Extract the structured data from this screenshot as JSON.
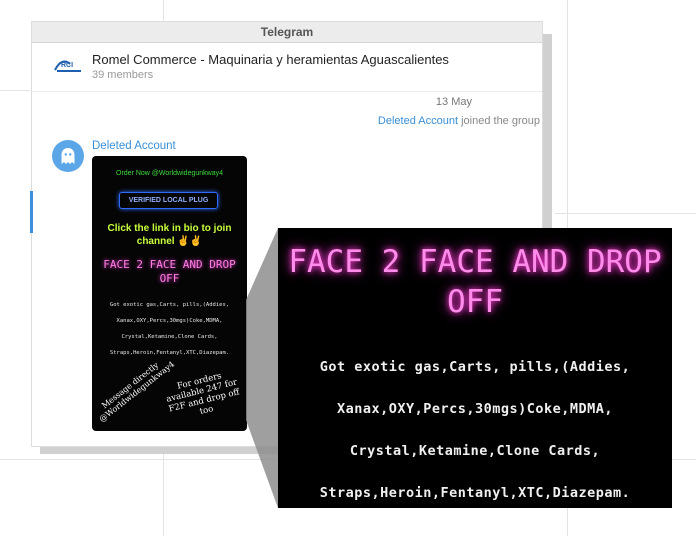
{
  "window": {
    "title": "Telegram"
  },
  "chat": {
    "title": "Romel Commerce - Maquinaria y heramientas Aguascalientes",
    "members": "39 members"
  },
  "messages": {
    "date": "13 May",
    "service": {
      "user": "Deleted Account",
      "action": "joined the group"
    },
    "sender": "Deleted Account"
  },
  "photo": {
    "order_line": "Order Now @Worldwidegunkway4",
    "verified": "VERIFIED LOCAL PLUG",
    "click_line": "Click the link in bio to join channel ✌✌",
    "face_line": "FACE 2 FACE AND DROP OFF",
    "list": [
      "Got exotic gas,Carts, pills,(Addies,",
      "Xanax,OXY,Percs,30mgs)Coke,MDMA,",
      "Crystal,Ketamine,Clone Cards,",
      "Straps,Heroin,Fentanyl,XTC,Diazepam."
    ],
    "message_directly": "Message directly @Worldwidegunkway4",
    "orders": "For orders available 247 for F2F and drop off too"
  },
  "zoom": {
    "face_line": "FACE 2 FACE AND DROP OFF",
    "list": [
      "Got exotic gas,Carts, pills,(Addies,",
      "Xanax,OXY,Percs,30mgs)Coke,MDMA,",
      "Crystal,Ketamine,Clone Cards,",
      "Straps,Heroin,Fentanyl,XTC,Diazepam."
    ]
  },
  "icons": {
    "group_avatar": "company-logo-icon",
    "sender_avatar": "ghost-icon"
  },
  "colors": {
    "link": "#3a8fd6",
    "avatar": "#5aa6e6",
    "neon_pink": "#ff8cea",
    "neon_green": "#3ddb3d"
  }
}
